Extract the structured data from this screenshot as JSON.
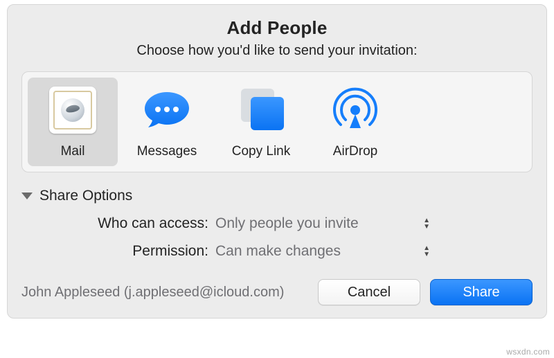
{
  "header": {
    "title": "Add People",
    "subtitle": "Choose how you'd like to send your invitation:"
  },
  "sendOptions": {
    "selectedIndex": 0,
    "items": [
      {
        "label": "Mail",
        "icon": "mail-icon"
      },
      {
        "label": "Messages",
        "icon": "messages-icon"
      },
      {
        "label": "Copy Link",
        "icon": "copy-link-icon"
      },
      {
        "label": "AirDrop",
        "icon": "airdrop-icon"
      }
    ]
  },
  "shareOptions": {
    "disclosureLabel": "Share Options",
    "expanded": true,
    "rows": {
      "access": {
        "label": "Who can access:",
        "value": "Only people you invite"
      },
      "permission": {
        "label": "Permission:",
        "value": "Can make changes"
      }
    }
  },
  "owner": {
    "display": "John Appleseed (j.appleseed@icloud.com)"
  },
  "buttons": {
    "cancel": "Cancel",
    "share": "Share"
  },
  "watermark": "wsxdn.com"
}
